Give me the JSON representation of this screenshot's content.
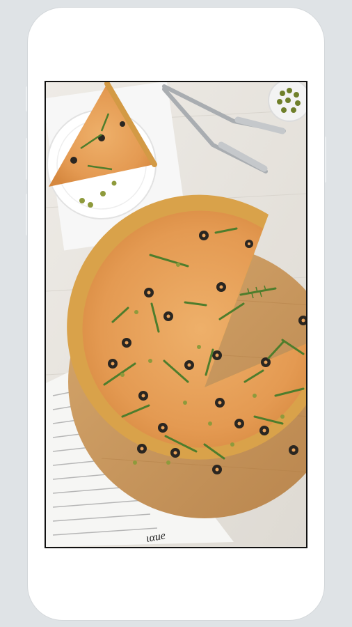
{
  "screen": {
    "image_label": "pizza-photo",
    "newspaper_word": "ιαue"
  },
  "colors": {
    "background": "#dfe3e6",
    "phone_body": "#ffffff",
    "screen_border": "#111111",
    "table": "#ebe8e3",
    "crust": "#d9a24a",
    "cheese": "#e9a35a",
    "olive": "#2a2621",
    "arugula": "#4e7d2c",
    "board": "#c99a60"
  }
}
